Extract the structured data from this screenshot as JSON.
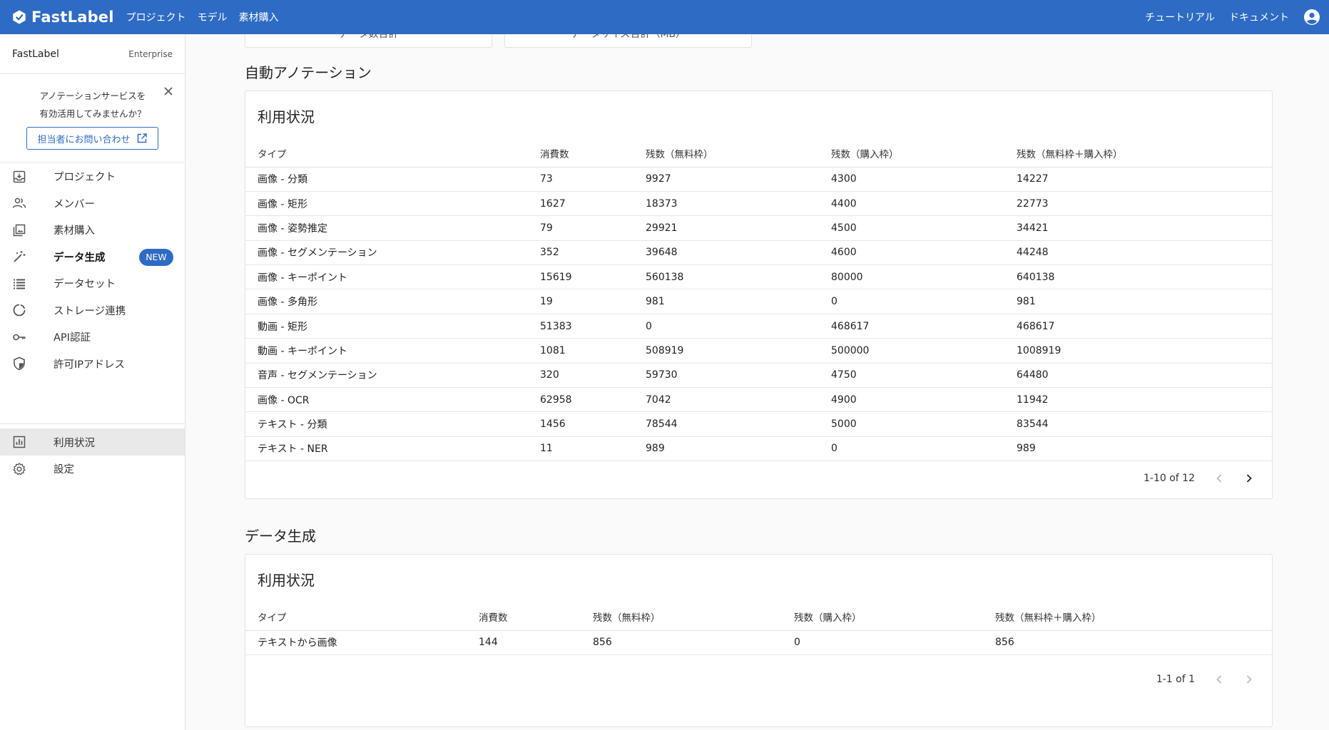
{
  "topbar": {
    "brand": "FastLabel",
    "nav": [
      "プロジェクト",
      "モデル",
      "素材購入"
    ],
    "right_links": [
      "チュートリアル",
      "ドキュメント"
    ]
  },
  "sidebar": {
    "org_name": "FastLabel",
    "org_plan": "Enterprise",
    "promo_line1": "アノテーションサービスを",
    "promo_line2": "有効活用してみませんか？",
    "promo_button": "担当者にお問い合わせ",
    "items": [
      {
        "label": "プロジェクト",
        "icon": "project-icon"
      },
      {
        "label": "メンバー",
        "icon": "members-icon"
      },
      {
        "label": "素材購入",
        "icon": "materials-icon"
      },
      {
        "label": "データ生成",
        "icon": "magic-wand-icon",
        "badge": "NEW"
      },
      {
        "label": "データセット",
        "icon": "dataset-icon"
      },
      {
        "label": "ストレージ連携",
        "icon": "storage-icon"
      },
      {
        "label": "API認証",
        "icon": "key-icon"
      },
      {
        "label": "許可IPアドレス",
        "icon": "shield-icon"
      }
    ],
    "items2": [
      {
        "label": "利用状況",
        "icon": "chart-icon"
      },
      {
        "label": "設定",
        "icon": "gear-icon"
      }
    ]
  },
  "stats": {
    "card1_label": "データ数合計",
    "card2_label": "データサイズ合計（MB）"
  },
  "auto_annotation": {
    "section_title": "自動アノテーション",
    "card_title": "利用状況",
    "headers": [
      "タイプ",
      "消費数",
      "残数（無料枠）",
      "残数（購入枠）",
      "残数（無料枠＋購入枠）"
    ],
    "rows": [
      [
        "画像 - 分類",
        "73",
        "9927",
        "4300",
        "14227"
      ],
      [
        "画像 - 矩形",
        "1627",
        "18373",
        "4400",
        "22773"
      ],
      [
        "画像 - 姿勢推定",
        "79",
        "29921",
        "4500",
        "34421"
      ],
      [
        "画像 - セグメンテーション",
        "352",
        "39648",
        "4600",
        "44248"
      ],
      [
        "画像 - キーポイント",
        "15619",
        "560138",
        "80000",
        "640138"
      ],
      [
        "画像 - 多角形",
        "19",
        "981",
        "0",
        "981"
      ],
      [
        "動画 - 矩形",
        "51383",
        "0",
        "468617",
        "468617"
      ],
      [
        "動画 - キーポイント",
        "1081",
        "508919",
        "500000",
        "1008919"
      ],
      [
        "音声 - セグメンテーション",
        "320",
        "59730",
        "4750",
        "64480"
      ],
      [
        "画像 - OCR",
        "62958",
        "7042",
        "4900",
        "11942"
      ],
      [
        "テキスト - 分類",
        "1456",
        "78544",
        "5000",
        "83544"
      ],
      [
        "テキスト - NER",
        "11",
        "989",
        "0",
        "989"
      ]
    ],
    "pagination": "1-10 of 12"
  },
  "data_generation": {
    "section_title": "データ生成",
    "card_title": "利用状況",
    "headers": [
      "タイプ",
      "消費数",
      "残数（無料枠）",
      "残数（購入枠）",
      "残数（無料枠＋購入枠）"
    ],
    "rows": [
      [
        "テキストから画像",
        "144",
        "856",
        "0",
        "856"
      ]
    ],
    "pagination": "1-1 of 1"
  }
}
